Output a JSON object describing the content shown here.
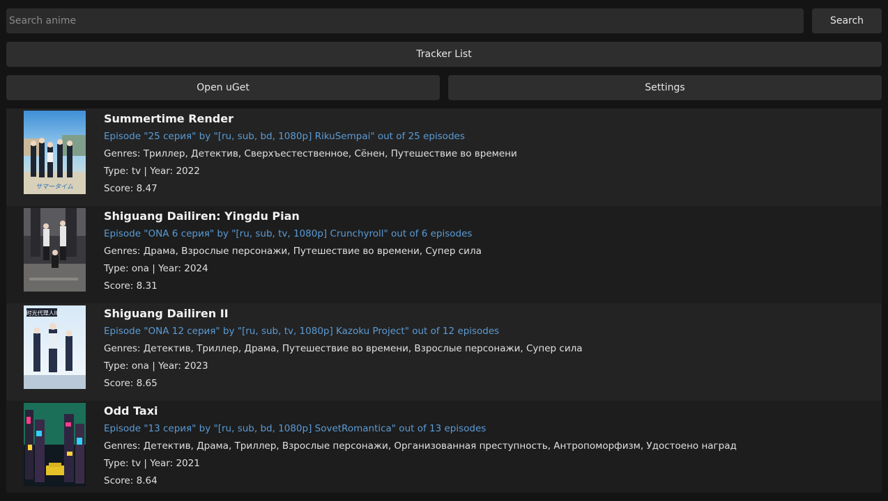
{
  "search": {
    "placeholder": "Search anime",
    "value": "",
    "button_label": "Search"
  },
  "toolbar": {
    "tracker_label": "Tracker List",
    "uget_label": "Open uGet",
    "settings_label": "Settings"
  },
  "colors": {
    "background": "#141414",
    "button": "#2e2e2e",
    "link": "#5b9bd5",
    "row_odd": "#232323",
    "row_even": "#1d1d1d"
  },
  "results": [
    {
      "title": "Summertime Render",
      "episode": "Episode \"25 серия\" by \"[ru, sub, bd, 1080p] RikuSempai\" out of 25 episodes",
      "genres": "Genres: Триллер, Детектив, Сверхъестественное, Сёнен, Путешествие во времени",
      "type_year": "Type: tv | Year: 2022",
      "score": "Score: 8.47",
      "poster_icon": "summertime-render-poster"
    },
    {
      "title": "Shiguang Dailiren: Yingdu Pian",
      "episode": "Episode \"ONA 6 серия\" by \"[ru, sub, tv, 1080p] Crunchyroll\" out of 6 episodes",
      "genres": "Genres: Драма, Взрослые персонажи, Путешествие во времени, Супер сила",
      "type_year": "Type: ona | Year: 2024",
      "score": "Score: 8.31",
      "poster_icon": "shiguang-dailiren-yingdu-poster"
    },
    {
      "title": "Shiguang Dailiren II",
      "episode": "Episode \"ONA 12 серия\" by \"[ru, sub, tv, 1080p] Kazoku Project\" out of 12 episodes",
      "genres": "Genres: Детектив, Триллер, Драма, Путешествие во времени, Взрослые персонажи, Супер сила",
      "type_year": "Type: ona | Year: 2023",
      "score": "Score: 8.65",
      "poster_icon": "shiguang-dailiren-ii-poster"
    },
    {
      "title": "Odd Taxi",
      "episode": "Episode \"13 серия\" by \"[ru, sub, bd, 1080p] SovetRomantica\" out of 13 episodes",
      "genres": "Genres: Детектив, Драма, Триллер, Взрослые персонажи, Организованная преступность, Антропоморфизм, Удостоено наград",
      "type_year": "Type: tv | Year: 2021",
      "score": "Score: 8.64",
      "poster_icon": "odd-taxi-poster"
    }
  ]
}
